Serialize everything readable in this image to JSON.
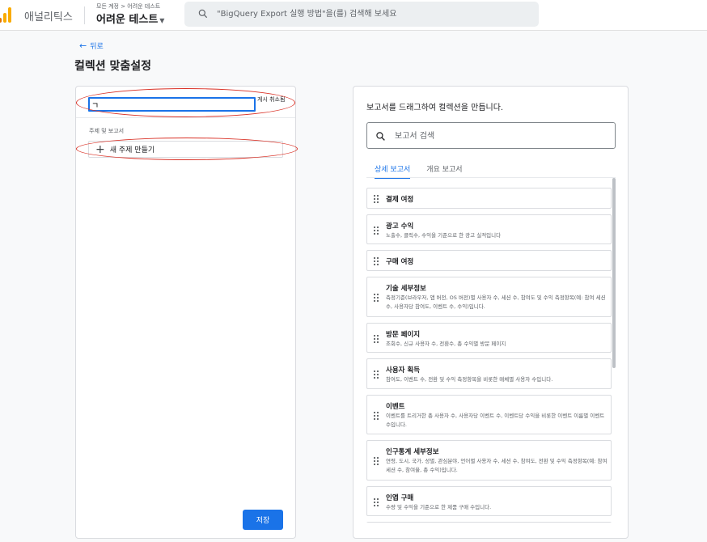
{
  "topbar": {
    "app_name": "애널리틱스",
    "account_crumb": "모든 계정 > 어려운 테스트",
    "property_name": "어려운 테스트",
    "search_placeholder": "\"BigQuery Export 실행 방법\"을(를) 검색해 보세요"
  },
  "header": {
    "back_label": "뒤로",
    "title": "컬렉션 맞춤설정"
  },
  "left_panel": {
    "name_input_value": "ㄱ",
    "cancel_edit_label": "게시 취소됨",
    "section_label": "주제 및 보고서",
    "new_topic_label": "새 주제 만들기",
    "save_label": "저장"
  },
  "right_panel": {
    "drag_hint": "보고서를 드래그하여 컬렉션을 만듭니다.",
    "search_placeholder": "보고서 검색",
    "tabs": [
      {
        "label": "상세 보고서",
        "active": true
      },
      {
        "label": "개요 보고서",
        "active": false
      }
    ],
    "reports": [
      {
        "title": "결제 여정",
        "description": ""
      },
      {
        "title": "광고 수익",
        "description": "노출수, 클릭수, 수익을 기준으로 한 광고 실적입니다"
      },
      {
        "title": "구매 여정",
        "description": ""
      },
      {
        "title": "기술 세부정보",
        "description": "측정기준(브라우저, 앱 버전, OS 버전)별 사용자 수, 세션 수, 참여도 및 수익 측정항목(예: 참여 세션 수, 사용자당 참여도, 이벤트 수, 수익)입니다."
      },
      {
        "title": "방문 페이지",
        "description": "조회수, 신규 사용자 수, 전환수, 총 수익별 방문 페이지"
      },
      {
        "title": "사용자 획득",
        "description": "참여도, 이벤트 수, 전환 및 수익 측정항목을 비롯한 매체별 사용자 수입니다."
      },
      {
        "title": "이벤트",
        "description": "이벤트를 트리거한 총 사용자 수, 사용자당 이벤트 수, 이벤트당 수익을 비롯한 이벤트 이름별 이벤트 수입니다."
      },
      {
        "title": "인구통계 세부정보",
        "description": "연령, 도시, 국가, 성별, 관심분야, 언어별 사용자 수, 세션 수, 참여도, 전환 및 수익 측정항목(예: 참여 세션 수, 참여율, 총 수익)입니다."
      },
      {
        "title": "인앱 구매",
        "description": "수량 및 수익을 기준으로 한 제품 구매 수입니다."
      },
      {
        "title": "",
        "description": ""
      }
    ]
  },
  "colors": {
    "accent": "#1a73e8",
    "annotation": "#d93025",
    "logo_orange": "#f9ab00",
    "logo_dark_orange": "#e37400"
  }
}
